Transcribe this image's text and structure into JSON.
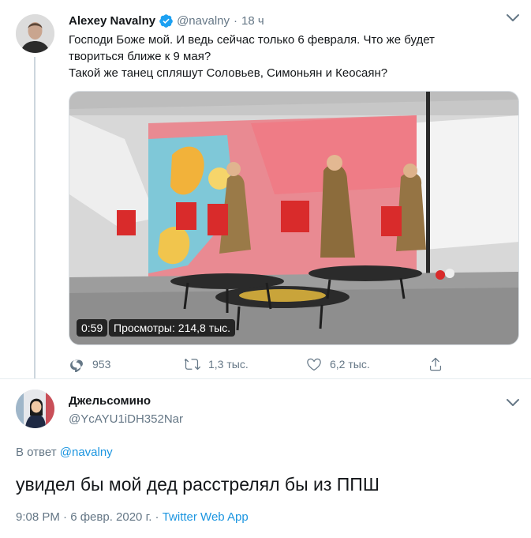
{
  "tweet": {
    "author_name": "Alexey Navalny",
    "handle": "@navalny",
    "separator": "·",
    "age": "18 ч",
    "text_lines": [
      "Господи Боже мой. И ведь сейчас только 6 февраля. Что же будет",
      "твориться ближе к 9 мая?",
      "Такой же танец спляшут Соловьев, Симоньян и Кеосаян?"
    ],
    "video": {
      "duration": "0:59",
      "views_label": "Просмотры: 214,8 тыс."
    },
    "actions": {
      "replies": "953",
      "retweets": "1,3 тыс.",
      "likes": "6,2 тыс."
    }
  },
  "reply": {
    "author_name": "Джельсомино",
    "handle": "@YcAYU1iDH352Nar",
    "reply_to_prefix": "В ответ",
    "reply_to_handle": "@navalny",
    "text": "увидел бы мой дед расстрелял бы из ППШ",
    "timestamp": "9:08 PM · 6 февр. 2020 г. · ",
    "source": "Twitter Web App"
  },
  "colors": {
    "accent": "#1b95e0",
    "muted": "#657786",
    "text": "#14171a",
    "verified": "#1da1f2"
  },
  "icons": [
    "verified-badge-icon",
    "chevron-down-icon",
    "reply-icon",
    "retweet-icon",
    "like-icon",
    "share-icon"
  ]
}
